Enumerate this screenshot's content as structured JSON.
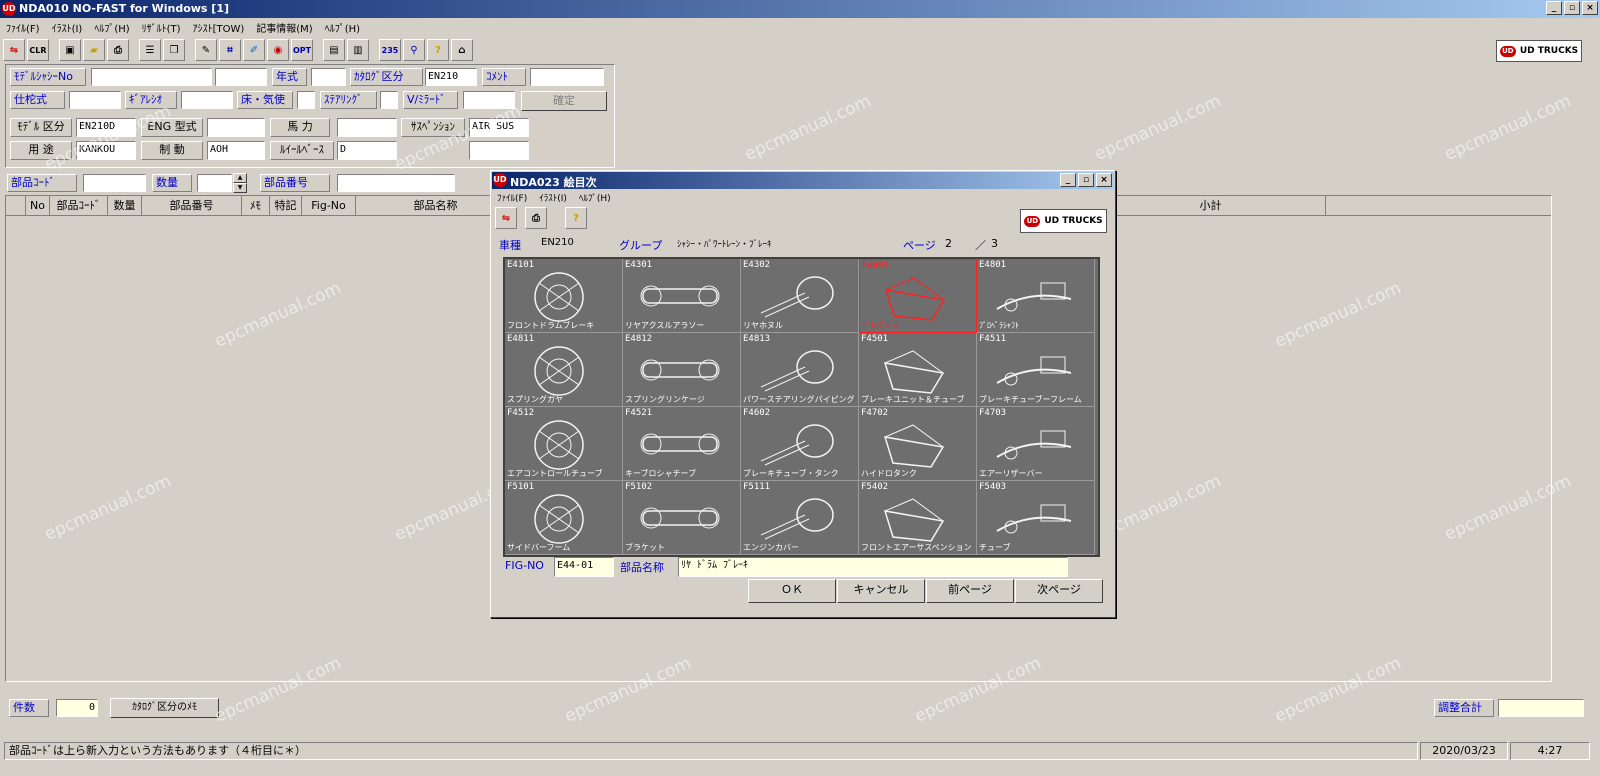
{
  "app": {
    "title": "NDA010 NO-FAST for Windows [1]",
    "icon_text": "UD",
    "menu": [
      "ﾌｧｲﾙ(F)",
      "ｲﾗｽﾄ(I)",
      "ﾍﾙﾌﾟ(H)",
      "ﾘｻﾞﾙﾄ(T)",
      "ｱｼｽﾄ[TOW)",
      "記事情報(M)",
      "ﾍﾙﾌﾟ(H)"
    ],
    "toolbar_labels": {
      "clr": "CLR",
      "opt": "OPT",
      "num": "235",
      "help": "?"
    },
    "brand": "UD TRUCKS",
    "brand_mark": "UD"
  },
  "form": {
    "model_chassis_label": "ﾓﾃﾞﾙｼｬｼｰNo",
    "model_chassis_value": "",
    "model_chassis_value2": "",
    "year_label": "年式",
    "year_value": "",
    "catalog_label": "ｶﾀﾛｸﾞ区分",
    "catalog_value": "EN210",
    "comment_label": "ｺﾒﾝﾄ",
    "comment_value": "",
    "spec_label": "仕柁式",
    "spec_value": "",
    "gear_label": "ｷﾞｱﾚｼｵ",
    "gear_value": "",
    "floor_label": "床・気使",
    "floor_value": "",
    "steering_label": "ｽﾃｱﾘﾝｸﾞ",
    "steering_value": "",
    "mirror_label": "V/ﾐﾗｰﾄﾞ",
    "mirror_value": "",
    "confirm_label": "確定",
    "model_class_label": "ﾓﾃﾞﾙ 区分",
    "model_class_value": "EN210D",
    "eng_label": "ENG 型式",
    "eng_value": "",
    "hp_label": "馬 力",
    "hp_value": "",
    "susp_label": "ｻｽﾍﾟﾝｼｮﾝ",
    "susp_value": "AIR SUS",
    "use_label": "用 途",
    "use_value": "KANKOU",
    "brake_label": "制 動",
    "brake_value": "AOH",
    "wheelbase_label": "ﾙｲｰﾙﾍﾞｰｽ",
    "wheelbase_value": "D",
    "extra_value": "",
    "partcode_label": "部品ｺｰﾄﾞ",
    "partcode_value": "",
    "qty_label": "数量",
    "qty_value": "",
    "partno_label": "部品番号",
    "partno_value": ""
  },
  "grid": {
    "columns": [
      "",
      "No",
      "部品ｺｰﾄﾞ",
      "数量",
      "部品番号",
      "ﾒﾓ",
      "特記",
      "Fig-No",
      "部品名称",
      "",
      "",
      "小計",
      ""
    ]
  },
  "bottom": {
    "count_label": "件数",
    "count_value": "0",
    "catalog_memo_button": "ｶﾀﾛｸﾞ区分のﾒﾓ",
    "adjust_label": "調整合計",
    "adjust_value": ""
  },
  "status": {
    "message": "部品ｺｰﾄﾞは上ら新入力という方法もあります（４桁目に＊）",
    "date": "2020/03/23",
    "time": "4:27"
  },
  "watermark": "epcmanual.com",
  "dialog": {
    "title": "NDA023 絵目次",
    "menu": [
      "ﾌｧｲﾙ(F)",
      "ｲﾗｽﾄ(I)",
      "ﾍﾙﾌﾟ(H)"
    ],
    "brand": "UD TRUCKS",
    "help_icon_text": "?",
    "vehicle_label": "車種",
    "vehicle_value": "EN210",
    "group_label": "グループ",
    "group_value": "ｼｬｼｰ・ﾊﾟﾜｰﾄﾚｰﾝ・ﾌﾞﾚｰｷ",
    "page_label": "ページ",
    "page_value": "2",
    "page_sep": "／",
    "page_total": "3",
    "thumbnails": [
      {
        "code": "E4101",
        "name": "フロントドラムブレーキ",
        "selected": false
      },
      {
        "code": "E4301",
        "name": "リヤアクスルアラソー",
        "selected": false
      },
      {
        "code": "E4302",
        "name": "リヤホヌル",
        "selected": false
      },
      {
        "code": "E4401",
        "name": "ﾄﾞﾗﾑﾌﾞﾚｰｷ",
        "selected": true
      },
      {
        "code": "E4801",
        "name": "ﾌﾟﾛﾍﾟﾗｼｬﾌﾄ",
        "selected": false
      },
      {
        "code": "E4811",
        "name": "スプリングガヤ",
        "selected": false
      },
      {
        "code": "E4812",
        "name": "スプリングリンケージ",
        "selected": false
      },
      {
        "code": "E4813",
        "name": "パワーステアリングパイピング",
        "selected": false
      },
      {
        "code": "F4501",
        "name": "ブレーキユニット＆チューブ",
        "selected": false
      },
      {
        "code": "F4511",
        "name": "ブレーキチューブーフレーム",
        "selected": false
      },
      {
        "code": "F4512",
        "name": "エアコントロールチューブ",
        "selected": false
      },
      {
        "code": "F4521",
        "name": "キーブロシャチーブ",
        "selected": false
      },
      {
        "code": "F4602",
        "name": "ブレーキチューブ・タンク",
        "selected": false
      },
      {
        "code": "F4702",
        "name": "ハイドロタンク",
        "selected": false
      },
      {
        "code": "F4703",
        "name": "エアーリザーバー",
        "selected": false
      },
      {
        "code": "F5101",
        "name": "サイドバーフーム",
        "selected": false
      },
      {
        "code": "F5102",
        "name": "ブラケット",
        "selected": false
      },
      {
        "code": "F5111",
        "name": "エンジンカバー",
        "selected": false
      },
      {
        "code": "F5402",
        "name": "フロントエアーサスペンション",
        "selected": false
      },
      {
        "code": "F5403",
        "name": "チューブ",
        "selected": false
      }
    ],
    "figno_label": "FIG-NO",
    "figno_value": "E44-01",
    "partname_label": "部品名称",
    "partname_value": "ﾘﾔ ﾄﾞﾗﾑ ﾌﾞﾚｰｷ",
    "ok": "ＯＫ",
    "cancel": "キャンセル",
    "prev": "前ページ",
    "next": "次ページ"
  }
}
